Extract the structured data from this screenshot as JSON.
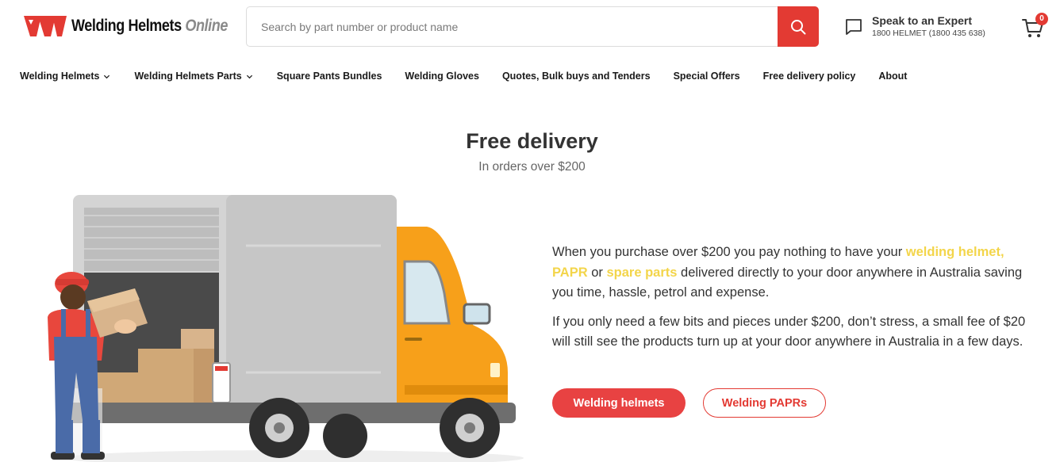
{
  "header": {
    "logo_text_main": "Welding Helmets",
    "logo_text_accent": "Online",
    "search_placeholder": "Search by part number or product name",
    "expert_title": "Speak to an Expert",
    "expert_phone": "1800 HELMET (1800 435 638)",
    "cart_count": "0"
  },
  "nav": {
    "items": [
      {
        "label": "Welding Helmets",
        "has_dropdown": true
      },
      {
        "label": "Welding Helmets Parts",
        "has_dropdown": true
      },
      {
        "label": "Square Pants Bundles",
        "has_dropdown": false
      },
      {
        "label": "Welding Gloves",
        "has_dropdown": false
      },
      {
        "label": "Quotes, Bulk buys and Tenders",
        "has_dropdown": false
      },
      {
        "label": "Special Offers",
        "has_dropdown": false
      },
      {
        "label": "Free delivery policy",
        "has_dropdown": false
      },
      {
        "label": "About",
        "has_dropdown": false
      }
    ]
  },
  "hero": {
    "title": "Free delivery",
    "subtitle": "In orders over $200"
  },
  "content": {
    "p1_before": "When you purchase over $200 you pay nothing to have your ",
    "p1_link1": "welding helmet, PAPR",
    "p1_mid": " or ",
    "p1_link2": "spare parts",
    "p1_after": " delivered directly to your door anywhere in Australia saving you time, hassle, petrol and expense.",
    "p2": "If you only need a few bits and pieces under $200, don’t stress, a small fee of $20 will still see the products turn up at your door anywhere in Australia in a few days."
  },
  "buttons": {
    "primary": "Welding helmets",
    "secondary": "Welding PAPRs"
  },
  "icons": {
    "search": "search-icon",
    "chat": "chat-bubble-icon",
    "cart": "cart-icon",
    "chevron": "chevron-down-icon"
  },
  "colors": {
    "accent_red": "#e33a33",
    "highlight_yellow": "#f3d54a",
    "truck_orange": "#f7a01a"
  }
}
